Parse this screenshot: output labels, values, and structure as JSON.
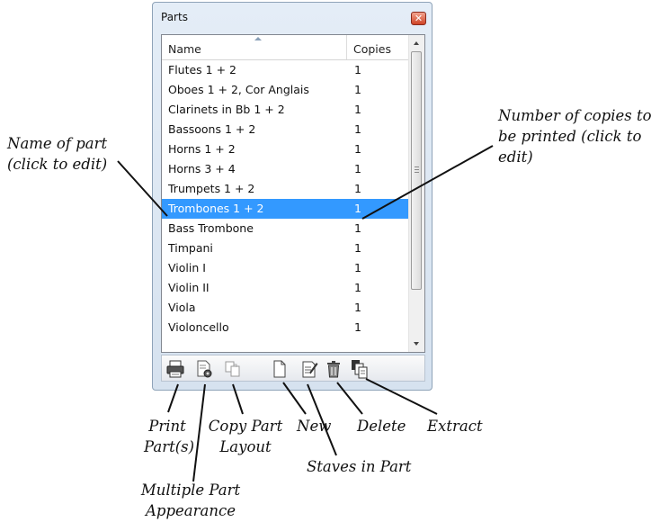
{
  "window": {
    "title": "Parts",
    "close_glyph": "✕"
  },
  "list": {
    "columns": {
      "name": "Name",
      "copies": "Copies"
    },
    "rows": [
      {
        "name": "Flutes 1 + 2",
        "copies": "1"
      },
      {
        "name": "Oboes 1 + 2, Cor Anglais",
        "copies": "1"
      },
      {
        "name": "Clarinets in Bb 1 + 2",
        "copies": "1"
      },
      {
        "name": "Bassoons 1 + 2",
        "copies": "1"
      },
      {
        "name": "Horns 1 + 2",
        "copies": "1"
      },
      {
        "name": "Horns 3 + 4",
        "copies": "1"
      },
      {
        "name": "Trumpets 1 + 2",
        "copies": "1"
      },
      {
        "name": "Trombones 1 + 2",
        "copies": "1",
        "selected": true
      },
      {
        "name": "Bass Trombone",
        "copies": "1"
      },
      {
        "name": "Timpani",
        "copies": "1"
      },
      {
        "name": "Violin I",
        "copies": "1"
      },
      {
        "name": "Violin II",
        "copies": "1"
      },
      {
        "name": "Viola",
        "copies": "1"
      },
      {
        "name": "Violoncello",
        "copies": "1"
      }
    ]
  },
  "toolbar": [
    {
      "icon": "printer-icon"
    },
    {
      "icon": "multiple-part-appearance-icon"
    },
    {
      "icon": "copy-part-layout-icon"
    },
    {
      "icon": "new-part-icon"
    },
    {
      "icon": "staves-in-part-icon"
    },
    {
      "icon": "delete-icon"
    },
    {
      "icon": "extract-icon"
    }
  ],
  "callouts": {
    "name_of_part": [
      "Name of part",
      "(click to edit)"
    ],
    "number_of_copies": [
      "Number of copies to",
      "be printed (click to",
      "edit)"
    ],
    "print_parts": [
      "Print",
      "Part(s)"
    ],
    "multiple_part_appearance": [
      "Multiple Part",
      "Appearance"
    ],
    "copy_part_layout": [
      "Copy Part",
      "Layout"
    ],
    "new": "New",
    "staves_in_part": "Staves in Part",
    "delete": "Delete",
    "extract": "Extract"
  },
  "colors": {
    "selection": "#3399ff",
    "window_frame": "#d6e2ef"
  }
}
